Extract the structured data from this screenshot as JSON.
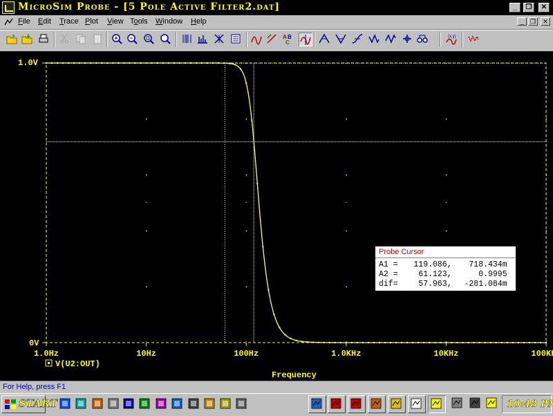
{
  "window": {
    "title": "MicroSim Probe - [5 Pole Active Filter2.dat]",
    "minimize_label": "_",
    "restore_label": "❐",
    "close_label": "✕"
  },
  "menu": {
    "items": [
      {
        "label": "File",
        "key": "F"
      },
      {
        "label": "Edit",
        "key": "E"
      },
      {
        "label": "Trace",
        "key": "T"
      },
      {
        "label": "Plot",
        "key": "P"
      },
      {
        "label": "View",
        "key": "V"
      },
      {
        "label": "Tools",
        "key": "o"
      },
      {
        "label": "Window",
        "key": "W"
      },
      {
        "label": "Help",
        "key": "H"
      }
    ]
  },
  "toolbar": {
    "icons": [
      "open-file-icon",
      "save-icon",
      "print-icon",
      "cut-icon",
      "copy-icon",
      "paste-icon",
      "zoom-in-icon",
      "zoom-out-icon",
      "zoom-area-icon",
      "zoom-fit-icon",
      "log-x-icon",
      "fourier-icon",
      "performance-icon",
      "eval-goal-icon",
      "add-trace-icon",
      "axis-settings-icon",
      "label-text-icon",
      "toggle-cursor-icon",
      "cursor-peak-icon",
      "cursor-trough-icon",
      "cursor-slope-icon",
      "cursor-min-icon",
      "cursor-max-icon",
      "cursor-point-icon",
      "cursor-search-icon",
      "mark-label-icon",
      "analog-digital-icon"
    ]
  },
  "plot": {
    "y_top_label": "1.0V",
    "y_bottom_label": "0V",
    "x_labels": [
      "1.0Hz",
      "10Hz",
      "100Hz",
      "1.0KHz",
      "10KHz",
      "100KHz"
    ],
    "trace_name": "V(U2:OUT)",
    "x_axis_title": "Frequency",
    "colors": {
      "background": "#000000",
      "axis": "#ffff00",
      "grid": "#ffff00",
      "trace": "#ffff80",
      "cursor": "#ffffff"
    }
  },
  "chart_data": {
    "type": "line",
    "x_scale": "log",
    "xlim": [
      1,
      100000
    ],
    "ylim": [
      0,
      1.0
    ],
    "xlabel": "Frequency",
    "ylabel": "",
    "title": "",
    "series": [
      {
        "name": "V(U2:OUT)",
        "filter_order": 5,
        "cutoff_hz": 120
      }
    ],
    "cursor_a1": {
      "x": 119.086,
      "y": 0.718434
    },
    "cursor_a2": {
      "x": 61.123,
      "y": 0.9995
    }
  },
  "probe_cursor": {
    "title": "Probe Cursor",
    "rows": [
      {
        "label": "A1 =",
        "x": "119.086,",
        "y": "718.434m"
      },
      {
        "label": "A2 =",
        "x": "61.123,",
        "y": "0.9995"
      },
      {
        "label": "dif=",
        "x": "57.963,",
        "y": "-281.084m"
      }
    ]
  },
  "status": {
    "text": "For Help, press F1"
  },
  "taskbar": {
    "start_label": "START",
    "clock": "10:48 PM",
    "quick_icons": [
      "ie-icon",
      "quick-edit-icon",
      "paint-icon",
      "document-icon",
      "word-icon",
      "excel-icon",
      "winzip-icon",
      "grid-icon",
      "timer-icon",
      "viewer-icon",
      "mosaic-icon",
      "clock-icon"
    ],
    "task_icons": [
      "magnifier-icon",
      "probe-task-icon",
      "schematic-icon",
      "parts-icon",
      "paint-task-icon",
      "notepad-task-icon",
      "probe-active-icon",
      "scroll-icon",
      "speaker-icon",
      "runner-icon"
    ]
  }
}
